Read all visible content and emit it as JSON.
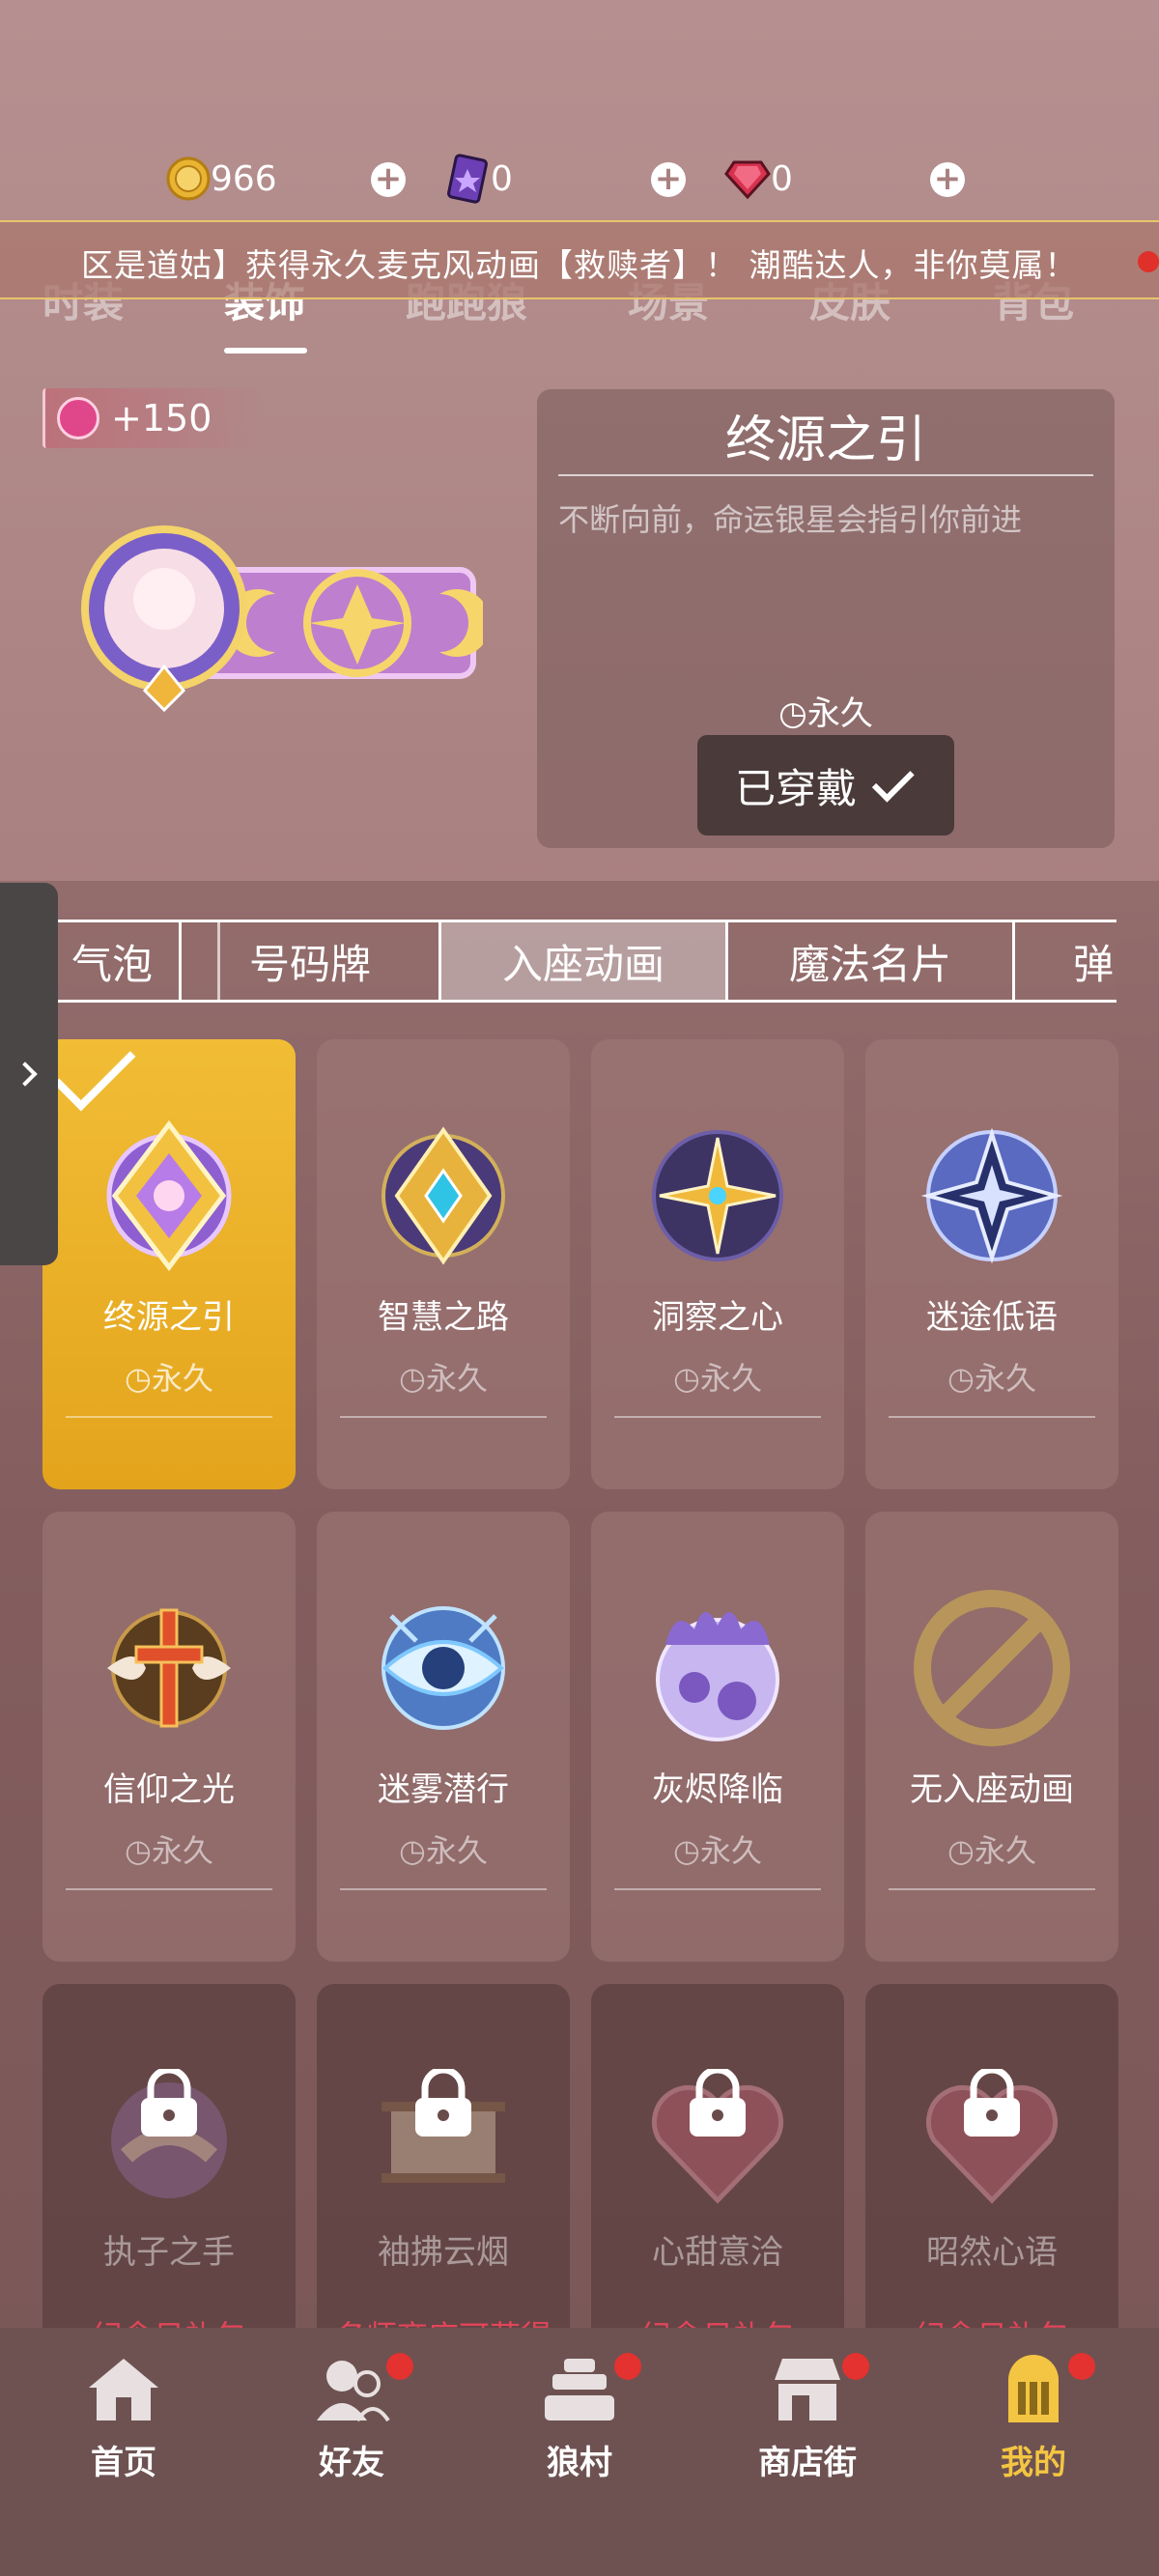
{
  "currency": {
    "coins": "966",
    "cards": "0",
    "gems": "0"
  },
  "marquee": {
    "text": "区是道姑】获得永久麦克风动画【救赎者】！ 潮酷达人，非你莫属！"
  },
  "top_tabs": [
    "时装",
    "装饰",
    "跑跑狼",
    "场景",
    "皮肤",
    "背包"
  ],
  "featured": {
    "points": "+150",
    "title": "终源之引",
    "description": "不断向前，命运银星会指引你前进",
    "duration": "永久",
    "equip_label": "已穿戴"
  },
  "sub_tabs": [
    "气泡",
    "号码牌",
    "入座动画",
    "魔法名片",
    "弹"
  ],
  "items": [
    {
      "name": "终源之引",
      "duration": "永久"
    },
    {
      "name": "智慧之路",
      "duration": "永久"
    },
    {
      "name": "洞察之心",
      "duration": "永久"
    },
    {
      "name": "迷途低语",
      "duration": "永久"
    },
    {
      "name": "信仰之光",
      "duration": "永久"
    },
    {
      "name": "迷雾潜行",
      "duration": "永久"
    },
    {
      "name": "灰烬降临",
      "duration": "永久"
    },
    {
      "name": "无入座动画",
      "duration": "永久"
    },
    {
      "name": "执子之手",
      "source": "纪念日礼包"
    },
    {
      "name": "袖拂云烟",
      "source": "名师商店可获得"
    },
    {
      "name": "心甜意洽",
      "source": "纪念日礼包"
    },
    {
      "name": "昭然心语",
      "source": "纪念日礼包"
    }
  ],
  "nav": [
    "首页",
    "好友",
    "狼村",
    "商店街",
    "我的"
  ],
  "colors": {
    "accent": "#f4c542",
    "selected_card": "#f1bd35",
    "alert": "#e3322f"
  }
}
